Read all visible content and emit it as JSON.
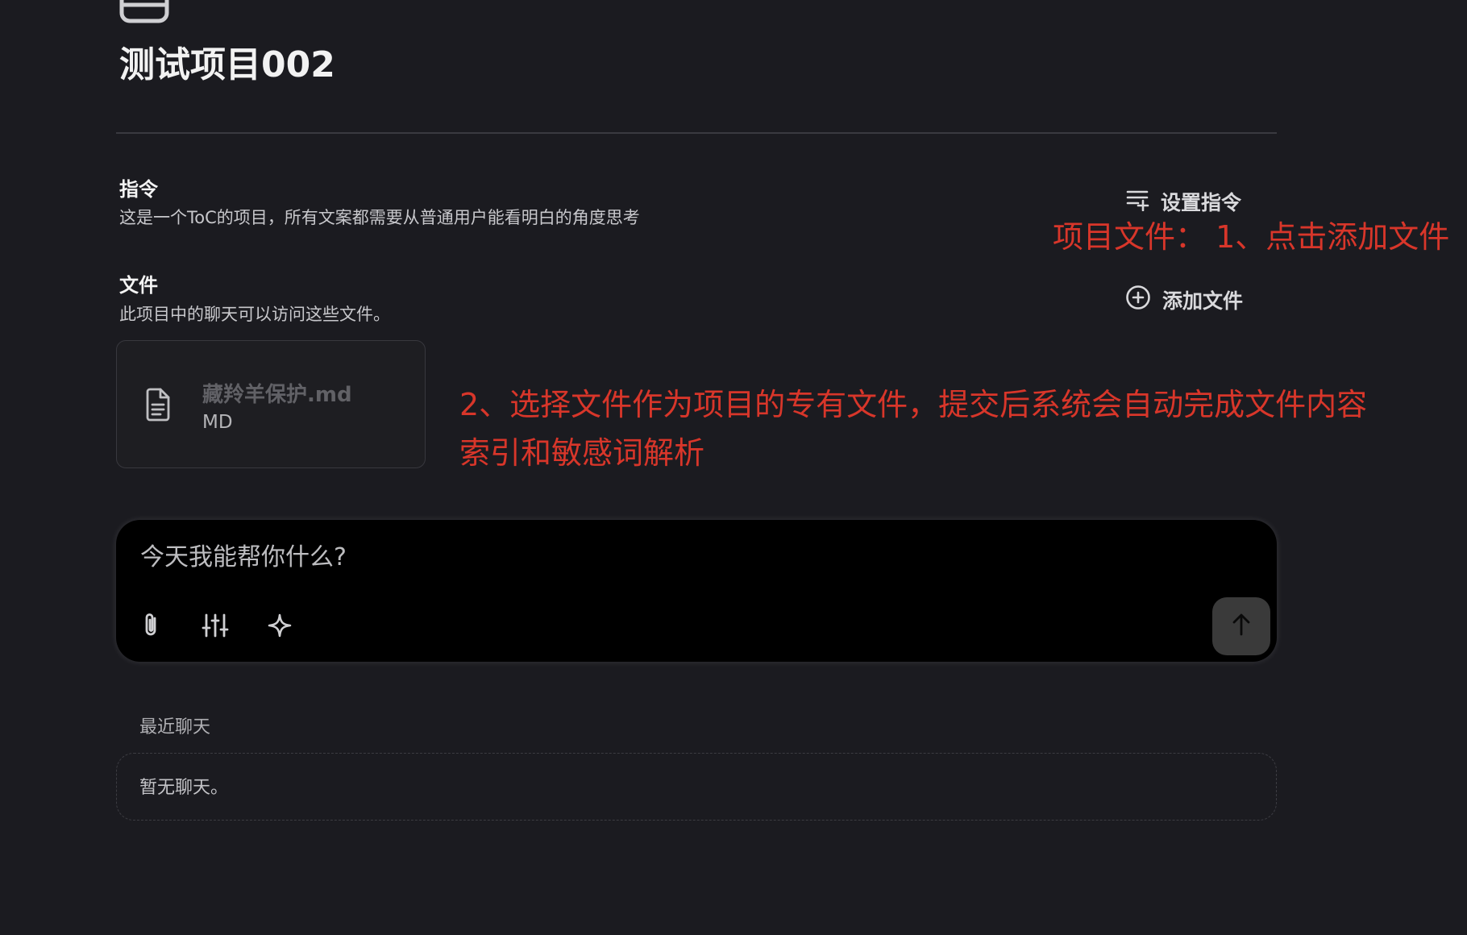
{
  "project": {
    "title": "测试项目002",
    "icon": "archive-box-icon"
  },
  "instructions": {
    "heading": "指令",
    "description": "这是一个ToC的项目，所有文案都需要从普通用户能看明白的角度思考",
    "action_label": "设置指令",
    "action_icon": "list-settings-icon"
  },
  "files": {
    "heading": "文件",
    "description": "此项目中的聊天可以访问这些文件。",
    "action_label": "添加文件",
    "action_icon": "plus-circle-icon",
    "items": [
      {
        "name": "藏羚羊保护.md",
        "type": "MD",
        "icon": "document-icon"
      }
    ]
  },
  "annotations": {
    "step1": "项目文件： 1、点击添加文件",
    "step2_line1": "2、选择文件作为项目的专有文件，提交后系统会自动完成文件内容",
    "step2_line2": "索引和敏感词解析",
    "color": "#d8362a"
  },
  "composer": {
    "placeholder": "今天我能帮你什么?",
    "tools": [
      "paperclip-icon",
      "sliders-icon",
      "sparkle-icon"
    ],
    "send_icon": "arrow-up-icon"
  },
  "recent": {
    "label": "最近聊天",
    "empty_text": "暂无聊天。"
  }
}
